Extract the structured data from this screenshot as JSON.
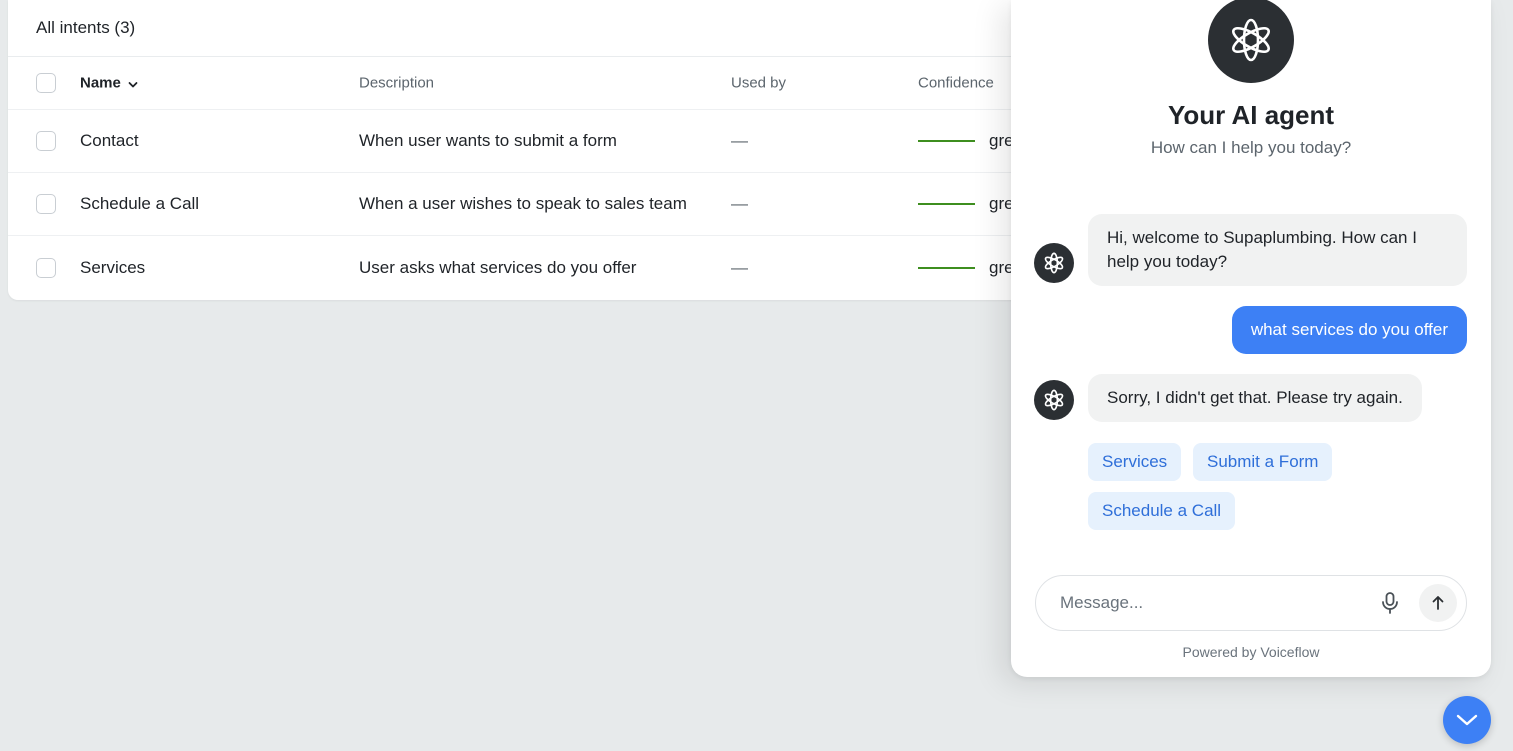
{
  "intents": {
    "header_title": "All intents (3)",
    "columns": {
      "name": "Name",
      "description": "Description",
      "used_by": "Used by",
      "confidence": "Confidence"
    },
    "rows": [
      {
        "name": "Contact",
        "description": "When user wants to submit a form",
        "used_by": "—",
        "confidence_label": "gre"
      },
      {
        "name": "Schedule a Call",
        "description": "When a user wishes to speak to sales team",
        "used_by": "—",
        "confidence_label": "gre"
      },
      {
        "name": "Services",
        "description": "User asks what services do you offer",
        "used_by": "—",
        "confidence_label": "gre"
      }
    ],
    "confidence_color": "#3e8e1f"
  },
  "chat": {
    "agent_title": "Your AI agent",
    "agent_subtitle": "How can I help you today?",
    "messages": [
      {
        "from": "bot",
        "text": "Hi, welcome to Supaplumbing. How can I help you today?"
      },
      {
        "from": "user",
        "text": "what services do you offer"
      },
      {
        "from": "bot",
        "text": "Sorry, I didn't get that. Please try again."
      }
    ],
    "quick_replies": [
      "Services",
      "Submit a Form",
      "Schedule a Call"
    ],
    "input_placeholder": "Message...",
    "powered_by": "Powered by Voiceflow",
    "accent_color": "#3d80f5",
    "icons": [
      "agent-logo-icon",
      "microphone-icon",
      "arrow-up-icon",
      "chevron-down-icon"
    ]
  }
}
